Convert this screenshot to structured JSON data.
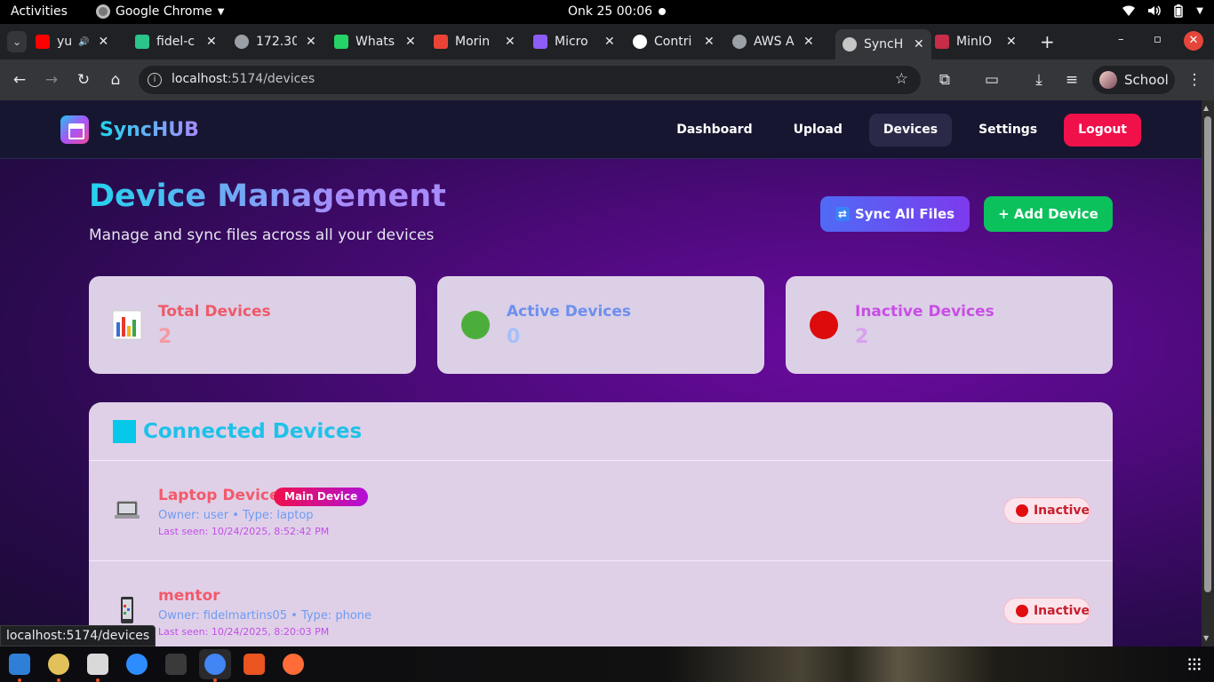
{
  "os_bar": {
    "activities": "Activities",
    "app_name": "Google Chrome",
    "clock": "Onk 25  00:06"
  },
  "browser": {
    "tabs": [
      {
        "title": "yu",
        "icon": "youtube-icon",
        "color": "#ff0000"
      },
      {
        "title": "fidel-c",
        "icon": "sync-icon",
        "color": "#2bc48a"
      },
      {
        "title": "172.30",
        "icon": "globe-icon",
        "color": "#9aa0a6"
      },
      {
        "title": "Whats",
        "icon": "whatsapp-icon",
        "color": "#25d366"
      },
      {
        "title": "Morin",
        "icon": "gmail-icon",
        "color": "#ea4335"
      },
      {
        "title": "Micro",
        "icon": "copilot-icon",
        "color": "#8b5cf6"
      },
      {
        "title": "Contri",
        "icon": "github-icon",
        "color": "#ffffff"
      },
      {
        "title": "AWS A",
        "icon": "globe-icon",
        "color": "#9aa0a6"
      },
      {
        "title": "SyncH",
        "icon": "synchub-icon",
        "color": "#c6c6c6"
      },
      {
        "title": "MinIO",
        "icon": "minio-icon",
        "color": "#c72c48"
      }
    ],
    "url_host": "localhost",
    "url_path": ":5174/devices",
    "profile_name": "School",
    "status_url": "localhost:5174/devices"
  },
  "app": {
    "brand": "SyncHUB",
    "nav": {
      "dashboard": "Dashboard",
      "upload": "Upload",
      "devices": "Devices",
      "settings": "Settings",
      "logout": "Logout"
    },
    "title": "Device Management",
    "subtitle": "Manage and sync files across all your devices",
    "sync_all_label": "Sync All Files",
    "add_device_label": "+ Add Device",
    "stats": [
      {
        "label": "Total Devices",
        "value": "2",
        "icon": "bar-chart-icon",
        "label_color": "#ee5a6a",
        "value_color": "#f59aa3"
      },
      {
        "label": "Active Devices",
        "value": "0",
        "icon": "green-circle-icon",
        "label_color": "#6d8ff0",
        "value_color": "#a6bff7"
      },
      {
        "label": "Inactive Devices",
        "value": "2",
        "icon": "red-circle-icon",
        "label_color": "#c94ee6",
        "value_color": "#d9a0f0"
      }
    ],
    "devices_section_title": "Connected Devices",
    "devices": [
      {
        "name": "Laptop Device",
        "badge": "Main Device",
        "owner_line": "Owner: user • Type: laptop",
        "last_seen": "Last seen: 10/24/2025, 8:52:42 PM",
        "status": "Inactive",
        "icon": "laptop-icon"
      },
      {
        "name": "mentor",
        "badge": "",
        "owner_line": "Owner: fidelmartins05 • Type: phone",
        "last_seen": "Last seen: 10/24/2025, 8:20:03 PM",
        "status": "Inactive",
        "icon": "phone-icon"
      }
    ]
  },
  "dock": [
    {
      "icon": "vscode-icon",
      "color": "#2f7fd6"
    },
    {
      "icon": "rhythmbox-icon",
      "color": "#e2c15a"
    },
    {
      "icon": "files-icon",
      "color": "#d9d9d9"
    },
    {
      "icon": "zoom-icon",
      "color": "#2d8cff"
    },
    {
      "icon": "terminal-icon",
      "color": "#3a3a3a"
    },
    {
      "icon": "chrome-icon",
      "color": "#4285f4"
    },
    {
      "icon": "app-center-icon",
      "color": "#e95420"
    },
    {
      "icon": "postman-icon",
      "color": "#ff6c37"
    }
  ]
}
